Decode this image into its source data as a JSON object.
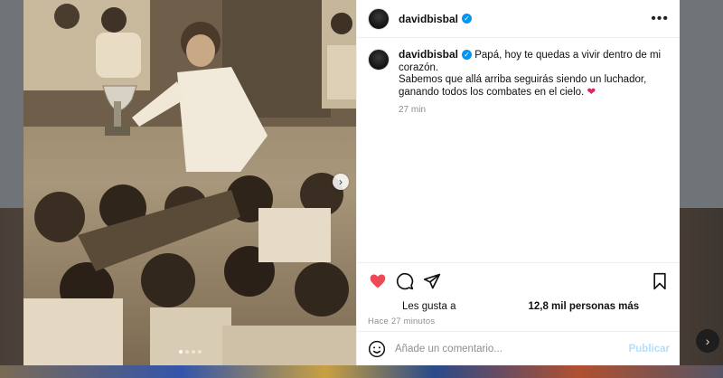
{
  "post": {
    "username": "davidbisbal",
    "verified_mark": "✓",
    "more_symbol": "•••",
    "caption_line1": "Papá, hoy te quedas a vivir dentro de mi corazón.",
    "caption_line2": "Sabemos que allá arriba seguirás siendo un luchador,",
    "caption_line3": "ganando todos los combates en el cielo.",
    "caption_emoji": "❤",
    "time_short": "27 min",
    "likes_prefix": "Les gusta a",
    "likes_count": "12,8 mil personas más",
    "time_long": "Hace 27 minutos",
    "liked": true
  },
  "carousel": {
    "next_symbol": "›",
    "slides": 4,
    "active_slide": 1
  },
  "comment_box": {
    "placeholder": "Añade un comentario...",
    "submit_label": "Publicar"
  },
  "background": {
    "nav_symbol": "›"
  },
  "icons": {
    "like": "heart-icon",
    "comment": "comment-icon",
    "share": "share-icon",
    "save": "bookmark-icon",
    "emoji": "emoji-icon",
    "more": "more-icon"
  },
  "colors": {
    "like": "#ed4956",
    "verified": "#0095f6",
    "post_button_disabled": "#b2dffc"
  }
}
